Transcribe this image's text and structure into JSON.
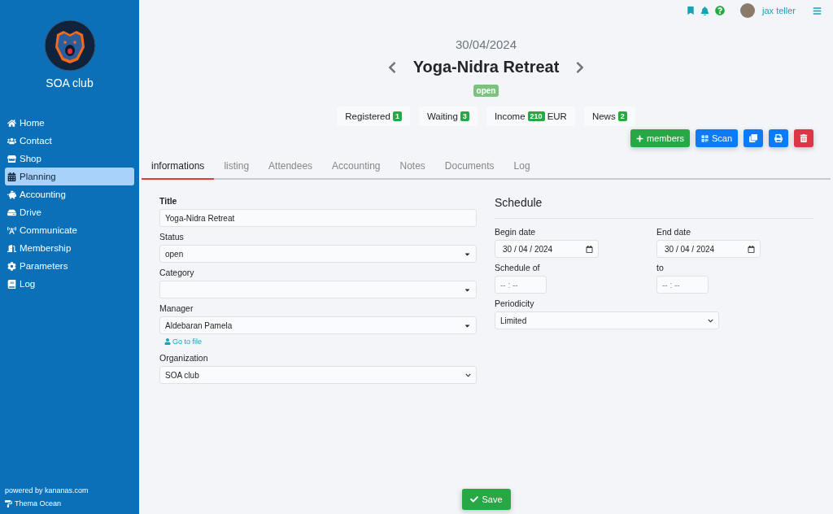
{
  "sidebar": {
    "club_name": "SOA club",
    "nav": [
      {
        "label": "Home",
        "selected": false
      },
      {
        "label": "Contact",
        "selected": false
      },
      {
        "label": "Shop",
        "selected": false
      },
      {
        "label": "Planning",
        "selected": true
      },
      {
        "label": "Accounting",
        "selected": false
      },
      {
        "label": "Drive",
        "selected": false
      },
      {
        "label": "Communicate",
        "selected": false
      },
      {
        "label": "Membership",
        "selected": false
      },
      {
        "label": "Parameters",
        "selected": false
      },
      {
        "label": "Log",
        "selected": false
      }
    ],
    "powered_by": "powered by kananas.com",
    "theme": "Thema Ocean"
  },
  "topbar": {
    "user_name": "jax teller"
  },
  "header": {
    "date": "30/04/2024",
    "title": "Yoga-Nidra Retreat",
    "status": "open",
    "stats": [
      {
        "label": "Registered",
        "count": "1"
      },
      {
        "label": "Waiting",
        "count": "3"
      },
      {
        "label": "Income",
        "count": "210",
        "suffix": "EUR"
      },
      {
        "label": "News",
        "count": "2"
      }
    ],
    "actions": [
      {
        "kind": "members",
        "label": "members"
      },
      {
        "kind": "scan",
        "label": "Scan"
      },
      {
        "kind": "copy"
      },
      {
        "kind": "print"
      },
      {
        "kind": "delete"
      }
    ]
  },
  "tabs": [
    {
      "label": "informations",
      "selected": true
    },
    {
      "label": "listing",
      "selected": false
    },
    {
      "label": "Attendees",
      "selected": false
    },
    {
      "label": "Accounting",
      "selected": false
    },
    {
      "label": "Notes",
      "selected": false
    },
    {
      "label": "Documents",
      "selected": false
    },
    {
      "label": "Log",
      "selected": false
    }
  ],
  "form": {
    "fields": [
      {
        "kind": "text",
        "label": "Title",
        "value": "Yoga-Nidra Retreat"
      },
      {
        "kind": "select",
        "label": "Status",
        "value": "open"
      },
      {
        "kind": "select",
        "label": "Category"
      },
      {
        "kind": "select",
        "label": "Manager",
        "value": "Aldebaran Pamela",
        "link": "Go to file"
      },
      {
        "kind": "native",
        "label": "Organization",
        "value": "SOA club"
      }
    ]
  },
  "schedule": {
    "heading": "Schedule",
    "rows": [
      [
        {
          "kind": "date",
          "label": "Begin date",
          "value": "30 / 04 / 2024"
        },
        {
          "kind": "date",
          "label": "End date",
          "value": "30 / 04 / 2024"
        }
      ],
      [
        {
          "kind": "time",
          "label": "Schedule of",
          "placeholder": "-- : --"
        },
        {
          "kind": "time",
          "label": "to",
          "placeholder": "-- : --"
        }
      ],
      [
        {
          "kind": "native",
          "label": "Periodicity",
          "value": "Limited"
        }
      ]
    ]
  },
  "save_label": "Save"
}
